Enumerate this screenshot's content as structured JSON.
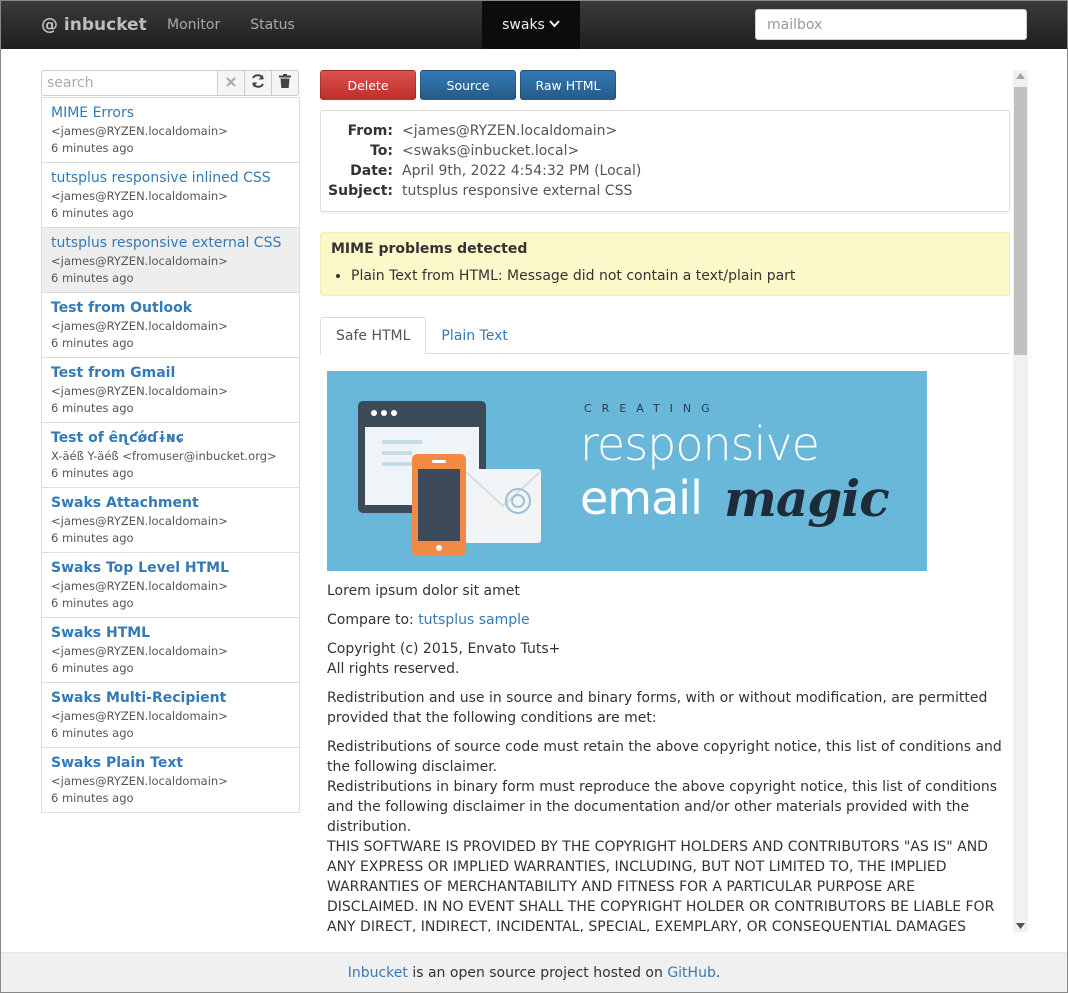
{
  "topbar": {
    "brand": "@ inbucket",
    "nav": [
      {
        "label": "Monitor"
      },
      {
        "label": "Status"
      }
    ],
    "active_mailbox": "swaks",
    "mailbox_placeholder": "mailbox"
  },
  "sidebar": {
    "search_placeholder": "search",
    "messages": [
      {
        "subject": "MIME Errors",
        "from": "<james@RYZEN.localdomain>",
        "date": "6 minutes ago",
        "unread": false,
        "selected": false
      },
      {
        "subject": "tutsplus responsive inlined CSS",
        "from": "<james@RYZEN.localdomain>",
        "date": "6 minutes ago",
        "unread": false,
        "selected": false
      },
      {
        "subject": "tutsplus responsive external CSS",
        "from": "<james@RYZEN.localdomain>",
        "date": "6 minutes ago",
        "unread": false,
        "selected": true
      },
      {
        "subject": "Test from Outlook",
        "from": "<james@RYZEN.localdomain>",
        "date": "6 minutes ago",
        "unread": true,
        "selected": false
      },
      {
        "subject": "Test from Gmail",
        "from": "<james@RYZEN.localdomain>",
        "date": "6 minutes ago",
        "unread": true,
        "selected": false
      },
      {
        "subject": "Test of ȇɳƈǿɗɨɴɕ",
        "from": "X-äéß Y-äéß <fromuser@inbucket.org>",
        "date": "6 minutes ago",
        "unread": true,
        "selected": false
      },
      {
        "subject": "Swaks Attachment",
        "from": "<james@RYZEN.localdomain>",
        "date": "6 minutes ago",
        "unread": true,
        "selected": false
      },
      {
        "subject": "Swaks Top Level HTML",
        "from": "<james@RYZEN.localdomain>",
        "date": "6 minutes ago",
        "unread": true,
        "selected": false
      },
      {
        "subject": "Swaks HTML",
        "from": "<james@RYZEN.localdomain>",
        "date": "6 minutes ago",
        "unread": true,
        "selected": false
      },
      {
        "subject": "Swaks Multi-Recipient",
        "from": "<james@RYZEN.localdomain>",
        "date": "6 minutes ago",
        "unread": true,
        "selected": false
      },
      {
        "subject": "Swaks Plain Text",
        "from": "<james@RYZEN.localdomain>",
        "date": "6 minutes ago",
        "unread": true,
        "selected": false
      }
    ]
  },
  "toolbar": {
    "delete_label": "Delete",
    "source_label": "Source",
    "raw_html_label": "Raw HTML"
  },
  "header": {
    "from_label": "From:",
    "from": "<james@RYZEN.localdomain>",
    "to_label": "To:",
    "to": "<swaks@inbucket.local>",
    "date_label": "Date:",
    "date": "April 9th, 2022 4:54:32 PM (Local)",
    "subject_label": "Subject:",
    "subject": "tutsplus responsive external CSS"
  },
  "alert": {
    "title": "MIME problems detected",
    "items": [
      "Plain Text from HTML: Message did not contain a text/plain part"
    ]
  },
  "tabs": [
    {
      "label": "Safe HTML",
      "active": true
    },
    {
      "label": "Plain Text",
      "active": false
    }
  ],
  "banner": {
    "creating": "CREATING",
    "line1": "responsive",
    "line2": "email",
    "line3": "magic"
  },
  "body": {
    "p1": "Lorem ipsum dolor sit amet",
    "compare_prefix": "Compare to: ",
    "compare_link": "tutsplus sample",
    "copyright": "Copyright (c) 2015, Envato Tuts+",
    "rights": "All rights reserved.",
    "p_redistribution": "Redistribution and use in source and binary forms, with or without modification, are permitted provided that the following conditions are met:",
    "p_cond1": "Redistributions of source code must retain the above copyright notice, this list of conditions and the following disclaimer.",
    "p_cond2": "Redistributions in binary form must reproduce the above copyright notice, this list of conditions and the following disclaimer in the documentation and/or other materials provided with the distribution.",
    "p_disclaimer": "THIS SOFTWARE IS PROVIDED BY THE COPYRIGHT HOLDERS AND CONTRIBUTORS \"AS IS\" AND ANY EXPRESS OR IMPLIED WARRANTIES, INCLUDING, BUT NOT LIMITED TO, THE IMPLIED WARRANTIES OF MERCHANTABILITY AND FITNESS FOR A PARTICULAR PURPOSE ARE DISCLAIMED. IN NO EVENT SHALL THE COPYRIGHT HOLDER OR CONTRIBUTORS BE LIABLE FOR ANY DIRECT, INDIRECT, INCIDENTAL, SPECIAL, EXEMPLARY, OR CONSEQUENTIAL DAMAGES (INCLUDING, BUT NOT LIMITED TO, PROCUREMENT OF SUBSTITUTE GOODS OR SERVICES; LOSS OF USE, DATA, OR PROFITS; OR BUSINESS"
  },
  "footer": {
    "inbucket_link": "Inbucket",
    "middle": " is an open source project hosted on ",
    "github_link": "GitHub",
    "end": "."
  },
  "colors": {
    "link": "#337ab7",
    "danger": "#d9534f",
    "primary": "#337ab7",
    "alert_bg": "#fcf8c9",
    "banner_bg": "#6ab8d9"
  }
}
